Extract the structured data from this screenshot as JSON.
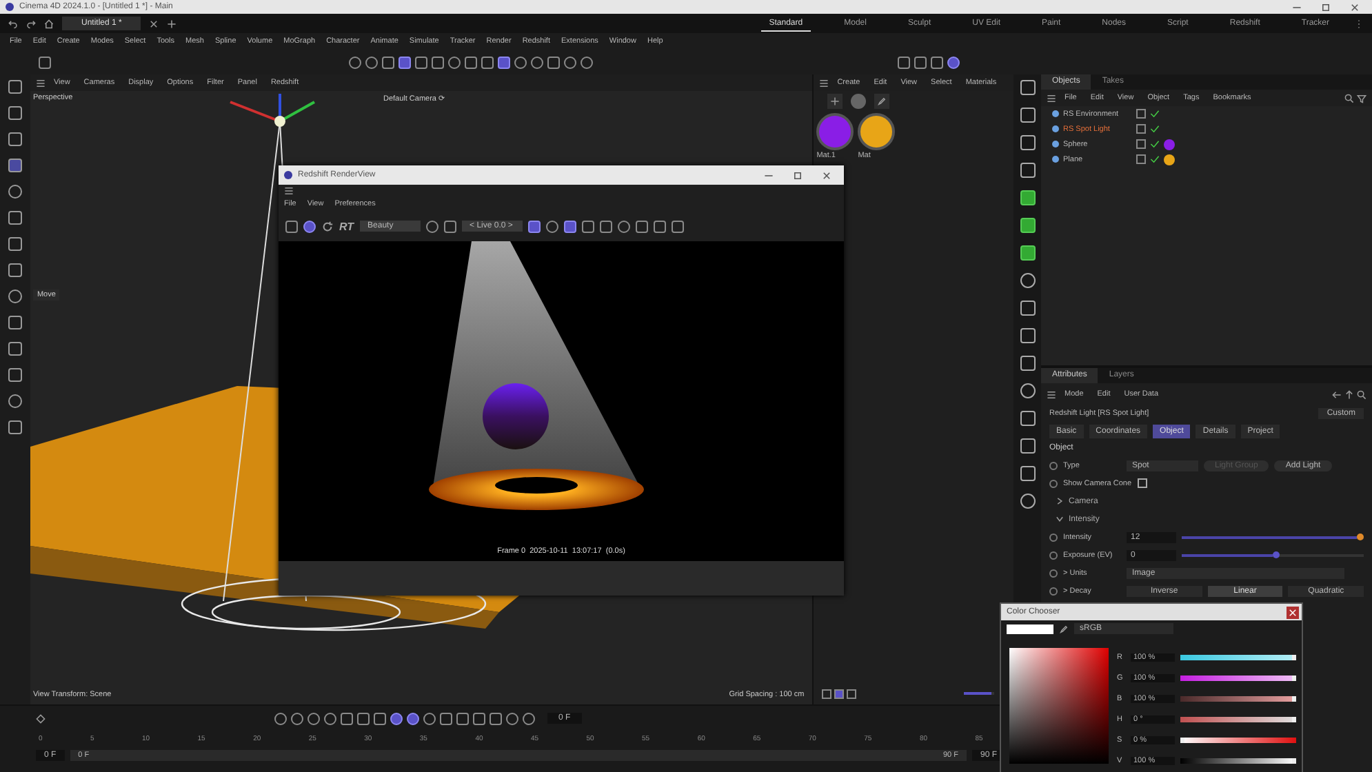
{
  "window": {
    "title": "Cinema 4D 2024.1.0 - [Untitled 1 *] - Main"
  },
  "doc_tabs": [
    {
      "label": "Untitled 1 *",
      "selected": true
    }
  ],
  "layouts": [
    {
      "label": "Standard",
      "selected": true
    },
    {
      "label": "Model",
      "selected": false
    },
    {
      "label": "Sculpt",
      "selected": false
    },
    {
      "label": "UV Edit",
      "selected": false
    },
    {
      "label": "Paint",
      "selected": false
    },
    {
      "label": "Nodes",
      "selected": false
    },
    {
      "label": "Script",
      "selected": false
    },
    {
      "label": "Redshift",
      "selected": false
    },
    {
      "label": "Tracker",
      "selected": false
    }
  ],
  "menu": [
    "File",
    "Edit",
    "Create",
    "Modes",
    "Select",
    "Tools",
    "Mesh",
    "Spline",
    "Volume",
    "MoGraph",
    "Character",
    "Animate",
    "Simulate",
    "Tracker",
    "Render",
    "Redshift",
    "Extensions",
    "Window",
    "Help"
  ],
  "viewport": {
    "menu": [
      "View",
      "Cameras",
      "Display",
      "Options",
      "Filter",
      "Panel",
      "Redshift"
    ],
    "camera_label": "Perspective",
    "camera_name": "Default Camera ⟳",
    "tool_hint": "Move",
    "hud_left": "View Transform: Scene",
    "hud_right": "Grid Spacing : 100 cm"
  },
  "materials": {
    "menu": [
      "Create",
      "Edit",
      "View",
      "Select",
      "Materials"
    ],
    "items": [
      {
        "name": "Mat.1",
        "color": "#8a1ee6"
      },
      {
        "name": "Mat",
        "color": "#e8a517"
      }
    ],
    "zoom_slider": {
      "level": 0.9
    }
  },
  "objects": {
    "tabs": [
      {
        "label": "Objects",
        "selected": true
      },
      {
        "label": "Takes",
        "selected": false
      }
    ],
    "menu": [
      "File",
      "Edit",
      "View",
      "Object",
      "Tags",
      "Bookmarks"
    ],
    "rows": [
      {
        "name": "RS Environment",
        "selected": false
      },
      {
        "name": "RS Spot Light",
        "selected": true
      },
      {
        "name": "Sphere",
        "selected": false,
        "color": "#8a1ee6"
      },
      {
        "name": "Plane",
        "selected": false,
        "color": "#e8a517"
      }
    ]
  },
  "attributes": {
    "tabs": [
      {
        "label": "Attributes",
        "selected": true
      },
      {
        "label": "Layers",
        "selected": false
      }
    ],
    "menu": [
      "Mode",
      "Edit",
      "User Data"
    ],
    "object_title": "Redshift Light [RS Spot Light]",
    "preset": "Custom",
    "sub_tabs": [
      {
        "label": "Basic",
        "selected": false
      },
      {
        "label": "Coordinates",
        "selected": false
      },
      {
        "label": "Object",
        "selected": true
      },
      {
        "label": "Details",
        "selected": false
      },
      {
        "label": "Project",
        "selected": false
      }
    ],
    "section": "Object",
    "type_label": "Type",
    "type_value": "Spot",
    "group_button": "Light Group",
    "add_button": "Add Light",
    "checkbox": {
      "label": "Show Camera Cone",
      "checked": false
    },
    "groups": [
      {
        "label": "Camera",
        "expanded": false
      },
      {
        "label": "Intensity",
        "expanded": true
      }
    ],
    "params": [
      {
        "label": "Intensity",
        "value": "12",
        "level": 1.0,
        "accent": true
      },
      {
        "label": "Exposure (EV)",
        "value": "0",
        "level": 0.5,
        "accent": false
      }
    ],
    "units": {
      "label": "> Units",
      "value": "Image"
    },
    "decay": {
      "label": "> Decay",
      "options": [
        {
          "label": "Inverse",
          "selected": false
        },
        {
          "label": "Linear",
          "selected": true
        },
        {
          "label": "Quadratic",
          "selected": false
        }
      ]
    }
  },
  "render_view": {
    "title": "Redshift RenderView",
    "menu": [
      "File",
      "View",
      "Preferences"
    ],
    "rt_label": "RT",
    "aov": "Beauty",
    "snapshot": "< Live 0.0 >",
    "footer": "Frame 0  2025-10-11  13:07:17  (0.0s)"
  },
  "color_chooser": {
    "title": "Color Chooser",
    "mode": "sRGB",
    "channels": [
      {
        "label": "R",
        "value": "100 %",
        "level": 1.0
      },
      {
        "label": "G",
        "value": "100 %",
        "level": 1.0
      },
      {
        "label": "B",
        "value": "100 %",
        "level": 1.0
      },
      {
        "label": "H",
        "value": "0 °",
        "level": 1.0
      },
      {
        "label": "S",
        "value": "0 %",
        "level": 0.0
      },
      {
        "label": "V",
        "value": "100 %",
        "level": 1.0
      }
    ]
  },
  "timeline": {
    "current_frame": "0 F",
    "ticks": [
      "0",
      "5",
      "10",
      "15",
      "20",
      "25",
      "30",
      "35",
      "40",
      "45",
      "50",
      "55",
      "60",
      "65",
      "70",
      "75",
      "80",
      "85"
    ],
    "start": "0 F",
    "range_start": "0 F",
    "range_end": "90 F",
    "end": "90 F"
  }
}
